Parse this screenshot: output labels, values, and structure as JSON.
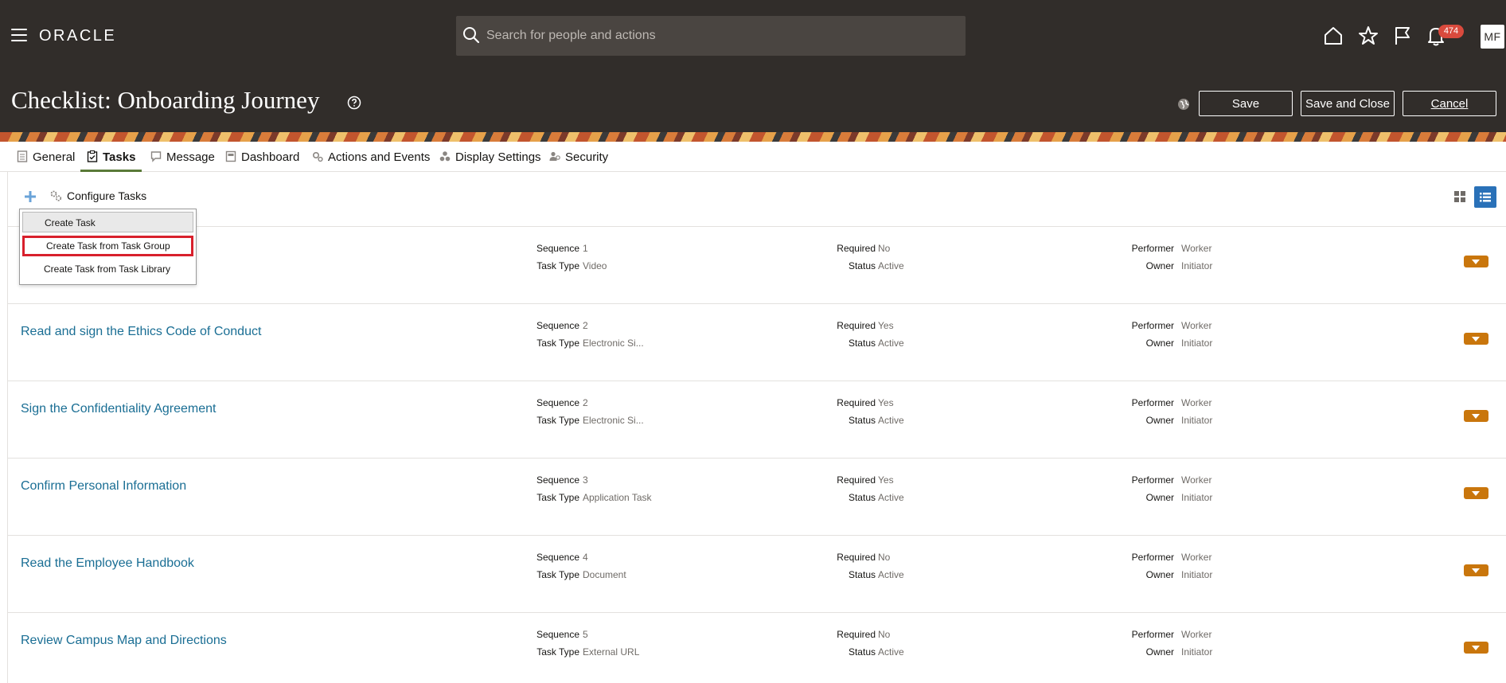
{
  "app": {
    "logo": "ORACLE",
    "search_placeholder": "Search for people and actions",
    "notification_count": "474",
    "avatar_initials": "MF"
  },
  "header": {
    "title": "Checklist: Onboarding Journey",
    "save": "Save",
    "save_and_close": "Save and Close",
    "cancel": "Cancel"
  },
  "tabs": [
    {
      "label": "General",
      "active": false
    },
    {
      "label": "Tasks",
      "active": true
    },
    {
      "label": "Message",
      "active": false
    },
    {
      "label": "Dashboard",
      "active": false
    },
    {
      "label": "Actions and Events",
      "active": false
    },
    {
      "label": "Display Settings",
      "active": false
    },
    {
      "label": "Security",
      "active": false
    }
  ],
  "toolbar": {
    "configure_tasks": "Configure Tasks"
  },
  "dropdown": {
    "items": [
      "Create Task",
      "Create Task from Task Group",
      "Create Task from Task Library"
    ],
    "highlight_color": "#d8202c"
  },
  "labels": {
    "sequence": "Sequence",
    "task_type": "Task Type",
    "required": "Required",
    "status": "Status",
    "performer": "Performer",
    "owner": "Owner"
  },
  "tasks": [
    {
      "name": "",
      "sequence": "1",
      "task_type": "Video",
      "required": "No",
      "status": "Active",
      "performer": "Worker",
      "owner": "Initiator"
    },
    {
      "name": "Read and sign the Ethics Code of Conduct",
      "sequence": "2",
      "task_type": "Electronic Si...",
      "required": "Yes",
      "status": "Active",
      "performer": "Worker",
      "owner": "Initiator"
    },
    {
      "name": "Sign the Confidentiality Agreement",
      "sequence": "2",
      "task_type": "Electronic Si...",
      "required": "Yes",
      "status": "Active",
      "performer": "Worker",
      "owner": "Initiator"
    },
    {
      "name": "Confirm Personal Information",
      "sequence": "3",
      "task_type": "Application Task",
      "required": "Yes",
      "status": "Active",
      "performer": "Worker",
      "owner": "Initiator"
    },
    {
      "name": "Read the Employee Handbook",
      "sequence": "4",
      "task_type": "Document",
      "required": "No",
      "status": "Active",
      "performer": "Worker",
      "owner": "Initiator"
    },
    {
      "name": "Review Campus Map and Directions",
      "sequence": "5",
      "task_type": "External URL",
      "required": "No",
      "status": "Active",
      "performer": "Worker",
      "owner": "Initiator"
    }
  ],
  "colors": {
    "header_bg": "#312d2a",
    "link": "#1a6e94",
    "accent_orange": "#c9760c",
    "active_tab": "#5a7a38",
    "list_view_active": "#2a71b8"
  }
}
